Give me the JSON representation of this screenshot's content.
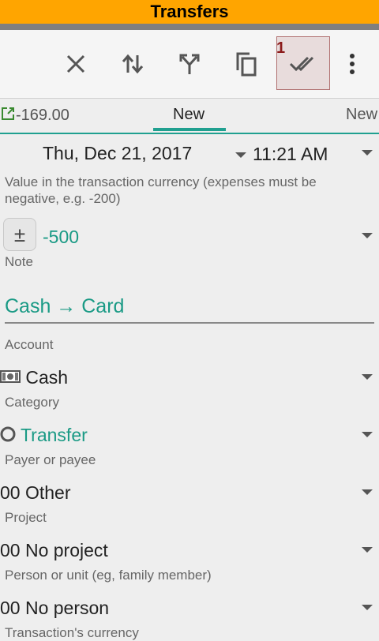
{
  "app": {
    "title": "Transfers"
  },
  "toolbar": {
    "icons": [
      "close-icon",
      "swap-icon",
      "split-icon",
      "copy-icon",
      "save-icon",
      "more-vert-icon"
    ],
    "badge": "1"
  },
  "tabs": {
    "left_amount": "-169.00",
    "items": [
      "New",
      "New"
    ]
  },
  "datetime": {
    "date": "Thu, Dec 21, 2017",
    "time": "11:21 AM"
  },
  "amount": {
    "hint": "Value in the transaction currency (expenses must be negative, e.g. -200)",
    "sign_label": "±",
    "value": "-500"
  },
  "note": {
    "label": "Note",
    "value": "Cash → Card"
  },
  "account": {
    "label": "Account",
    "value": "Cash"
  },
  "category": {
    "label": "Category",
    "value": "Transfer"
  },
  "payee": {
    "label": "Payer or payee",
    "value": "00 Other"
  },
  "project": {
    "label": "Project",
    "value": "00 No project"
  },
  "person": {
    "label": "Person or unit (eg, family member)",
    "value": "00 No person"
  },
  "currency": {
    "label": "Transaction's currency"
  },
  "colors": {
    "accent": "#1a9a85",
    "title_bar": "#ffa500",
    "highlight_border": "#b07070"
  }
}
